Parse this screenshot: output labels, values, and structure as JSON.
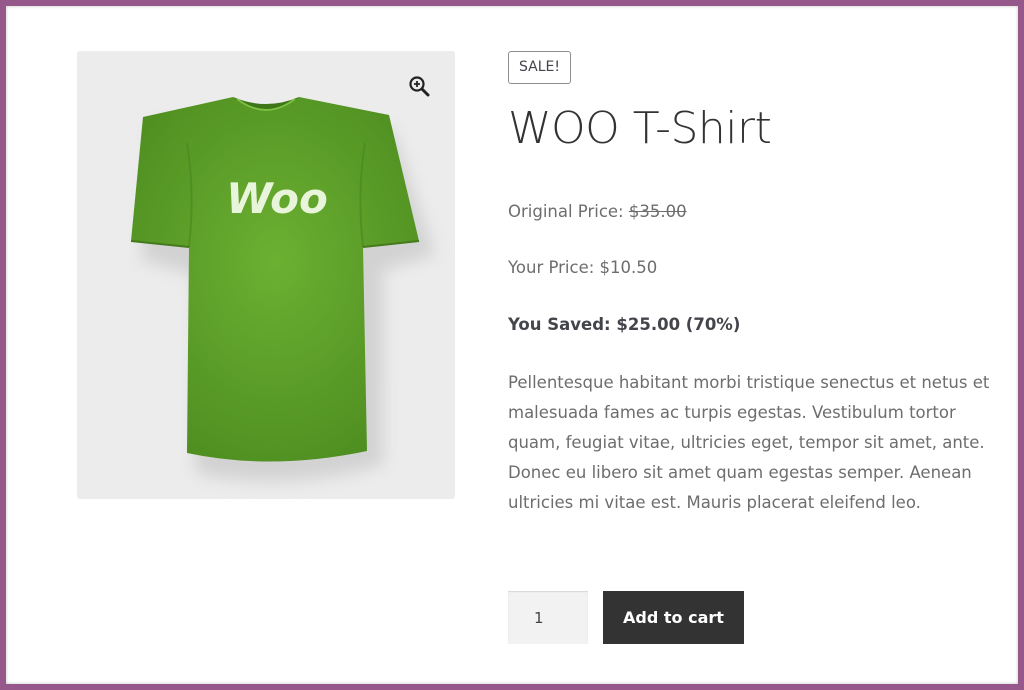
{
  "product": {
    "sale_badge": "SALE!",
    "title": "WOO T-Shirt",
    "image_text": "Woo",
    "original_price_label": "Original Price: ",
    "original_price": "$35.00",
    "your_price": "Your Price: $10.50",
    "you_saved": "You Saved: $25.00 (70%)",
    "description": "Pellentesque habitant morbi tristique senectus et netus et malesuada fames ac turpis egestas. Vestibulum tortor quam, feugiat vitae, ultricies eget, tempor sit amet, ante. Donec eu libero sit amet quam egestas semper. Aenean ultricies mi vitae est. Mauris placerat eleifend leo.",
    "shirt_color": "#5fa12d"
  },
  "cart": {
    "quantity": "1",
    "add_label": "Add to cart"
  },
  "icons": {
    "zoom": "magnifier-plus-icon"
  },
  "colors": {
    "frame_border": "#96588a",
    "button_bg": "#333333"
  }
}
